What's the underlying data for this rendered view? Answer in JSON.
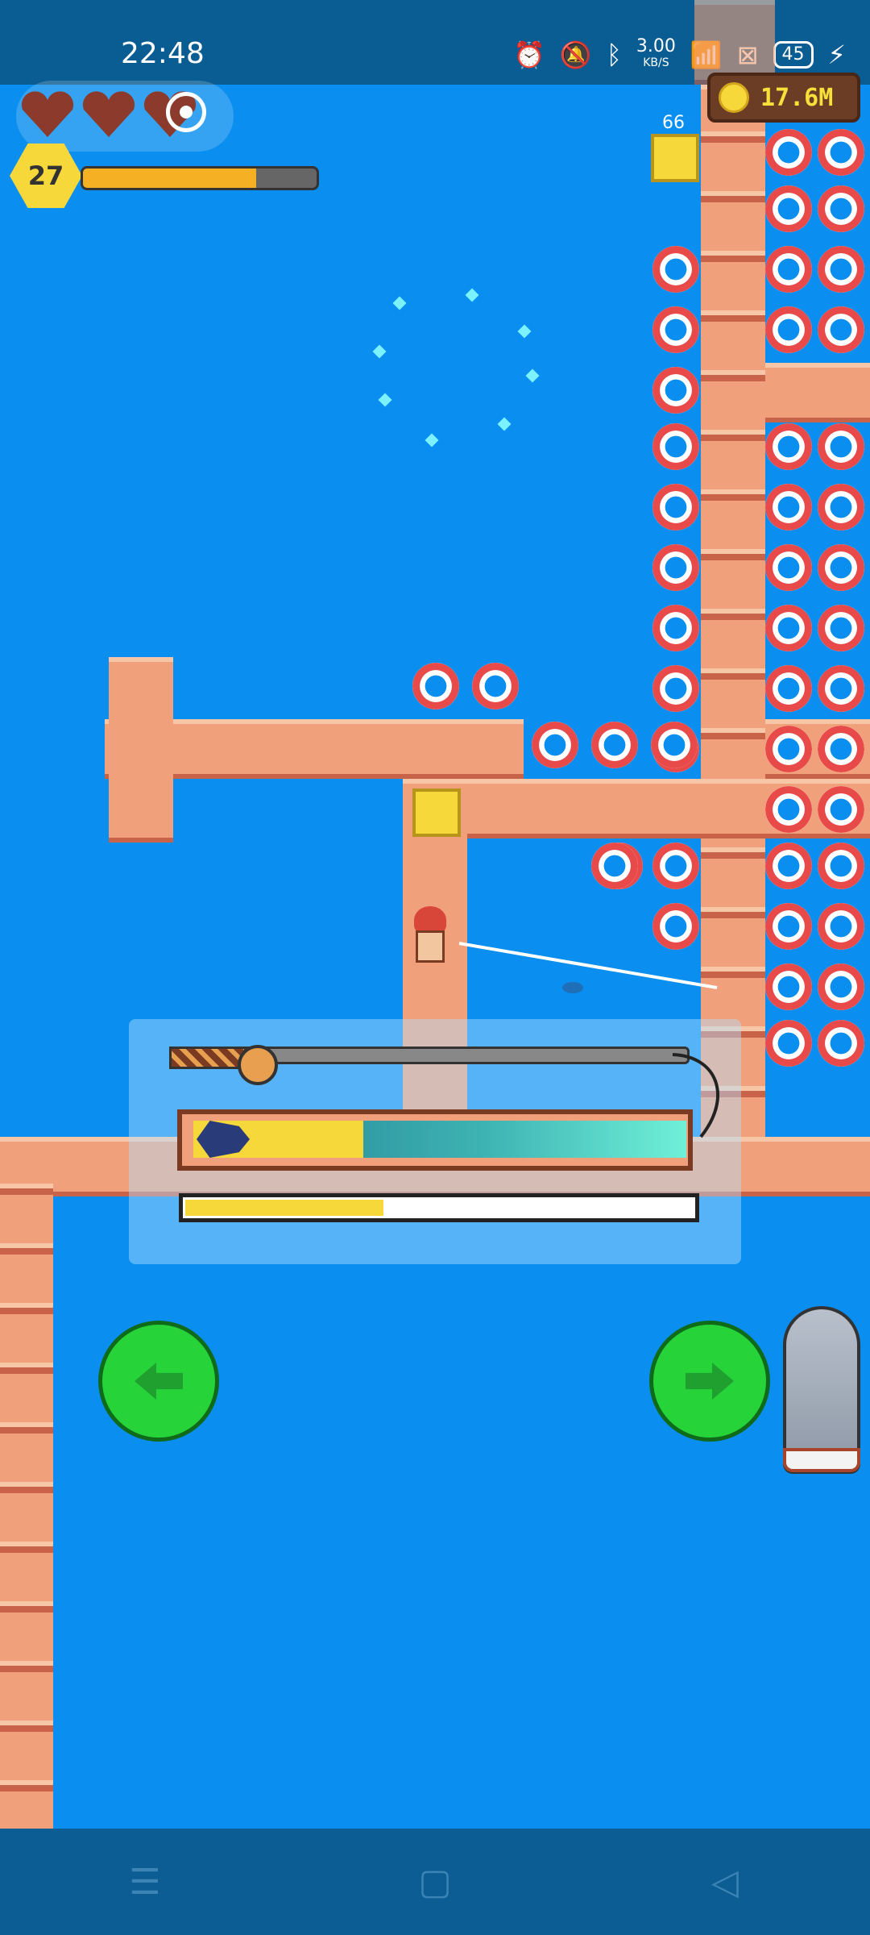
{
  "status_bar": {
    "time": "22:48",
    "net_speed_value": "3.00",
    "net_speed_unit": "KB/S",
    "battery": "45",
    "icons": [
      "alarm-icon",
      "mute-icon",
      "bluetooth-icon",
      "wifi-icon",
      "sim-icon",
      "battery-icon",
      "charging-icon"
    ]
  },
  "hud": {
    "hearts_count": 3,
    "player_level": "27",
    "xp_fraction": 0.74,
    "coins": "17.6M",
    "chest_count": "66"
  },
  "fishing": {
    "catch_progress": 0.23,
    "tension_progress": 0.39
  },
  "controls": {
    "left_button": "left-arrow-icon",
    "right_button": "right-arrow-icon",
    "boat": "boat-icon"
  },
  "nav_bar": {
    "menu_glyph": "☰",
    "home_glyph": "▢",
    "back_glyph": "◁"
  },
  "colors": {
    "water": "#0a8ff0",
    "dock": "#f0a07a",
    "accent_green": "#26d43a",
    "accent_yellow": "#f7d83a"
  }
}
